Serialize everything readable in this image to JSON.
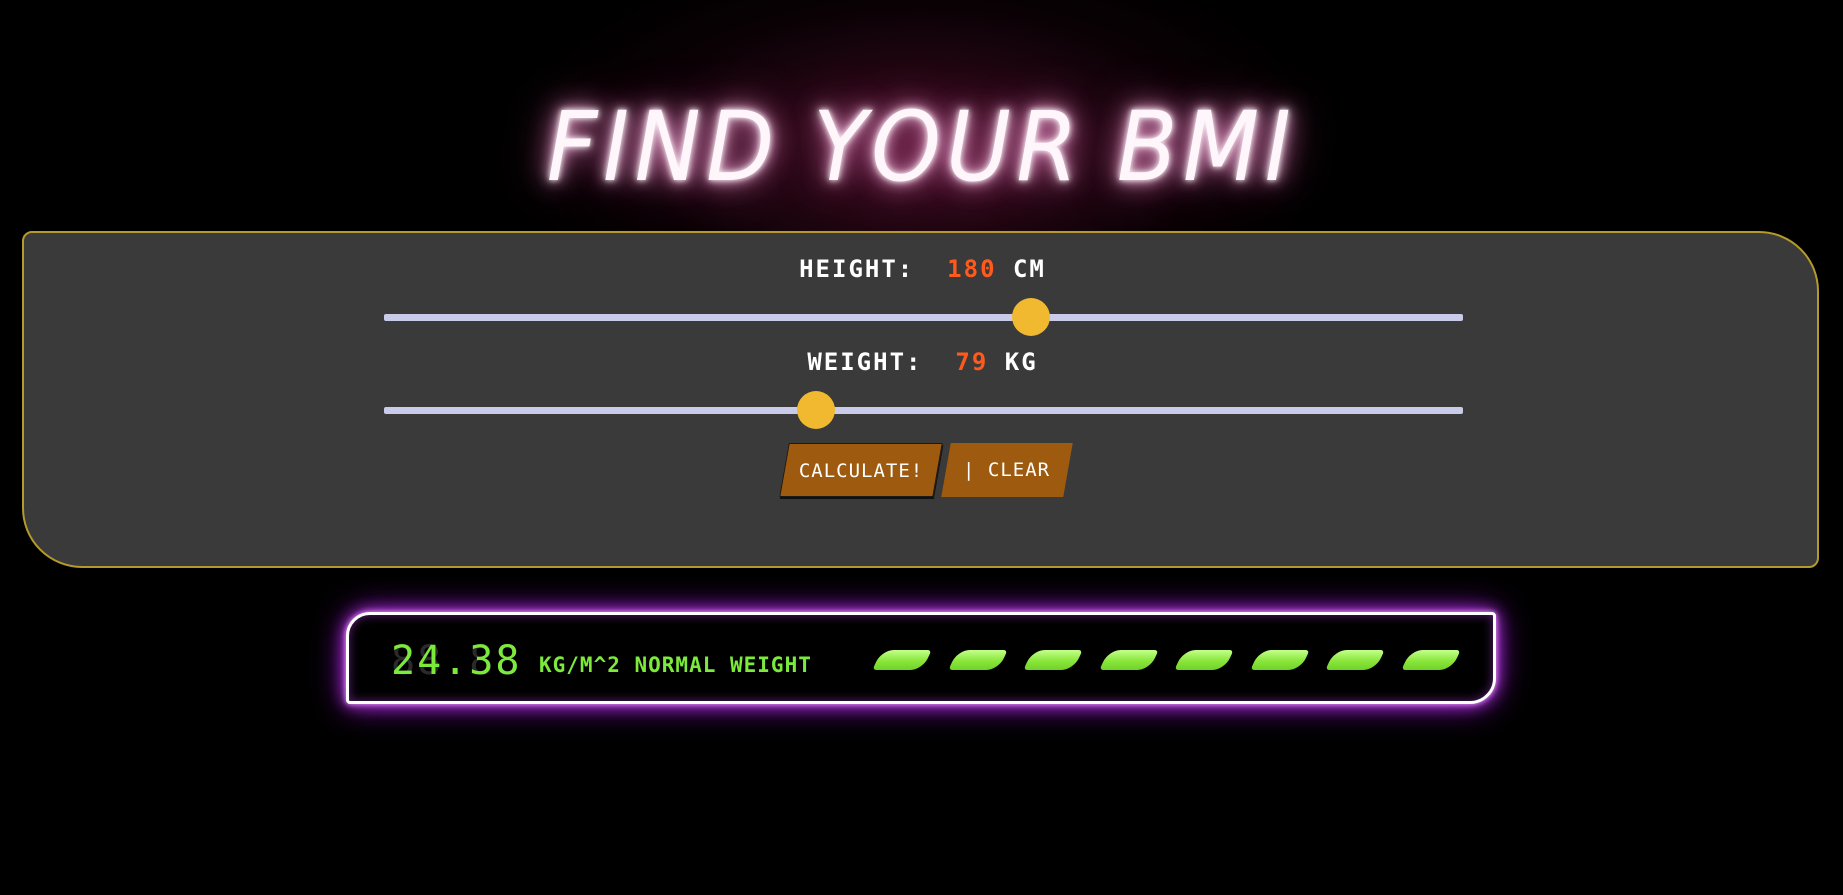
{
  "title": "FIND YOUR BMI",
  "height": {
    "label": "HEIGHT:",
    "value": "180",
    "unit": "CM",
    "slider_fraction": 0.6
  },
  "weight": {
    "label": "WEIGHT:",
    "value": "79",
    "unit": "KG",
    "slider_fraction": 0.4
  },
  "buttons": {
    "calculate": "CALCULATE!",
    "clear": "| CLEAR"
  },
  "result": {
    "bmi": "24.38",
    "bmi_ghost": "88.88",
    "unit_and_status": "KG/M^2 NORMAL WEIGHT",
    "indicator_segments_lit": 8
  },
  "colors": {
    "accent_orange": "#ff5a1c",
    "thumb": "#f0b92f",
    "button": "#9e5a0e",
    "lcd_green": "#7bea3a",
    "glow_purple": "#c33cf0"
  }
}
